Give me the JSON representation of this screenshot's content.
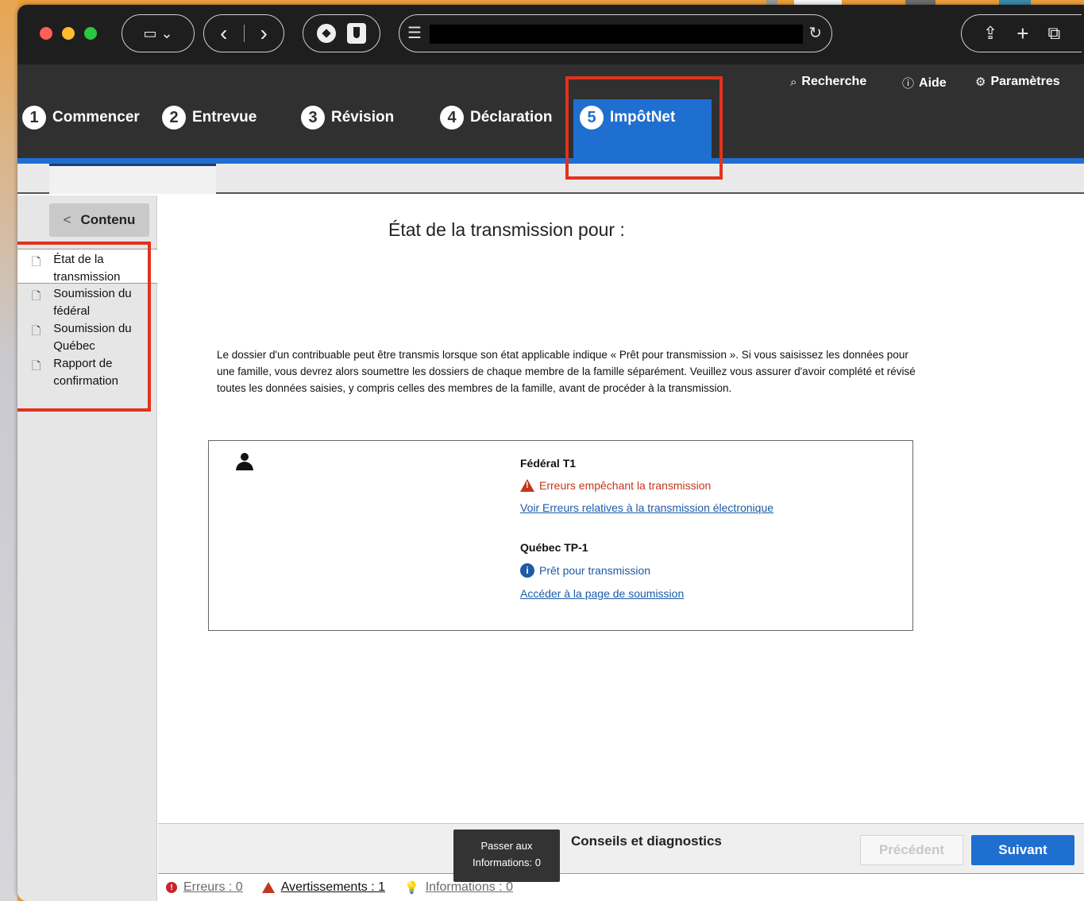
{
  "browser": {
    "toolbar_glyphs": {
      "sidebar": "▭ ⌄",
      "back": "‹",
      "forward": "›",
      "address_icon": "☰",
      "reload": "↻",
      "share": "⇪",
      "new_tab": "+",
      "tabs": "⧉"
    }
  },
  "header": {
    "utilities": [
      {
        "label": "Recherche",
        "icon": "search-icon",
        "glyph": "⌕"
      },
      {
        "label": "Aide",
        "icon": "help-icon",
        "glyph": "ⓘ"
      },
      {
        "label": "Paramètres",
        "icon": "gear-icon",
        "glyph": "⚙"
      }
    ],
    "steps": [
      {
        "num": "1",
        "label": "Commencer"
      },
      {
        "num": "2",
        "label": "Entrevue"
      },
      {
        "num": "3",
        "label": "Révision"
      },
      {
        "num": "4",
        "label": "Déclaration"
      },
      {
        "num": "5",
        "label": "ImpôtNet"
      }
    ]
  },
  "sidebar": {
    "toggle_label": "Contenu",
    "toggle_chevron": "<",
    "items": [
      {
        "label": "État de la transmission"
      },
      {
        "label": "Soumission du fédéral"
      },
      {
        "label": "Soumission du Québec"
      },
      {
        "label": "Rapport de confirmation"
      }
    ]
  },
  "main": {
    "title": "État de la transmission pour :",
    "intro": "Le dossier d'un contribuable peut être transmis lorsque son état applicable indique « Prêt pour transmission ». Si vous saisissez les données pour une famille, vous devrez alors soumettre les dossiers de chaque membre de la famille séparément. Veuillez vous assurer d'avoir complété et révisé toutes les données saisies, y compris celles des membres de la famille, avant de procéder à la transmission.",
    "federal": {
      "heading": "Fédéral T1",
      "status": "Erreurs empêchant la transmission",
      "link": "Voir Erreurs relatives à la transmission électronique"
    },
    "quebec": {
      "heading": "Québec TP-1",
      "status": "Prêt pour transmission",
      "link": "Accéder à la page de soumission"
    }
  },
  "footer": {
    "conseils": "Conseils et diagnostics",
    "prev": "Précédent",
    "next": "Suivant",
    "tooltip_line1": "Passer aux",
    "tooltip_line2": "Informations: 0",
    "errors": "Erreurs : 0",
    "warnings": "Avertissements : 1",
    "infos": "Informations : 0"
  },
  "colors": {
    "accent": "#1f6fd1",
    "header_bg": "#303030",
    "error": "#c2371d",
    "annotation": "#e2321d"
  }
}
